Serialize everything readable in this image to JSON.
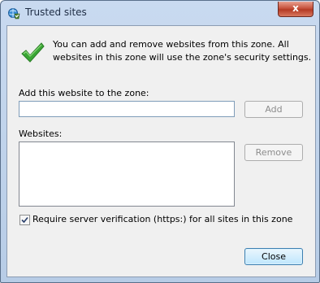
{
  "window": {
    "title": "Trusted sites",
    "close_glyph": "x"
  },
  "info": {
    "text": "You can add and remove websites from this zone. All websites in this zone will use the zone's security settings.",
    "icon": "green-check-icon"
  },
  "add": {
    "label": "Add this website to the zone:",
    "input_value": "",
    "button_label": "Add"
  },
  "websites": {
    "label": "Websites:",
    "items": [],
    "remove_label": "Remove"
  },
  "https_check": {
    "label": "Require server verification (https:) for all sites in this zone",
    "checked": true
  },
  "footer": {
    "close_label": "Close"
  },
  "colors": {
    "accent": "#3c7fb1",
    "check_green": "#3aa635"
  }
}
